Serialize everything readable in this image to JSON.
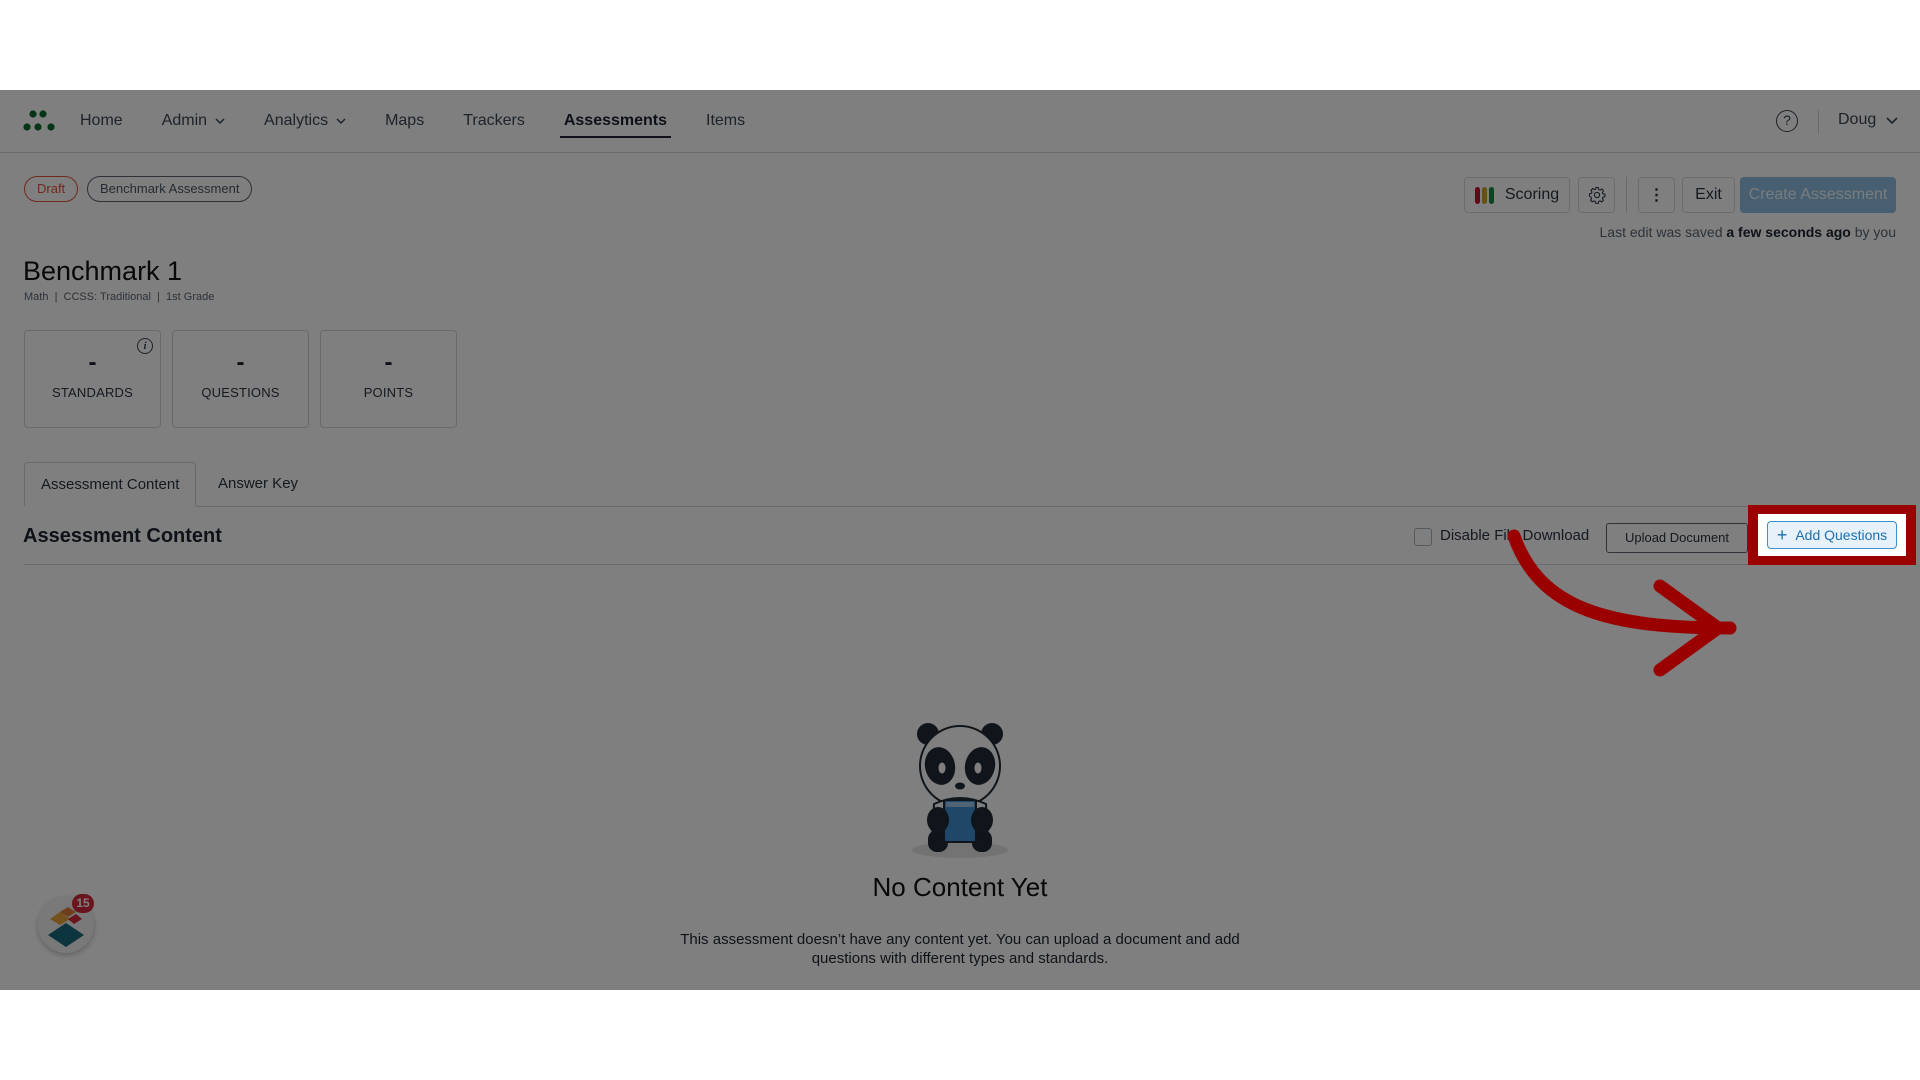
{
  "nav": {
    "items": [
      {
        "label": "Home",
        "has_dropdown": false,
        "active": false
      },
      {
        "label": "Admin",
        "has_dropdown": true,
        "active": false
      },
      {
        "label": "Analytics",
        "has_dropdown": true,
        "active": false
      },
      {
        "label": "Maps",
        "has_dropdown": false,
        "active": false
      },
      {
        "label": "Trackers",
        "has_dropdown": false,
        "active": false
      },
      {
        "label": "Assessments",
        "has_dropdown": false,
        "active": true
      },
      {
        "label": "Items",
        "has_dropdown": false,
        "active": false
      }
    ],
    "help_icon": "?",
    "user_name": "Doug"
  },
  "badges": {
    "status": "Draft",
    "type": "Benchmark Assessment"
  },
  "toolbar": {
    "scoring_label": "Scoring",
    "scoring_colors": [
      "#c8102e",
      "#c9a227",
      "#1f8a3c"
    ],
    "kebab_icon": "⋮",
    "exit_label": "Exit",
    "create_label": "Create Assessment",
    "saved_prefix": "Last edit was saved ",
    "saved_time": "a few seconds ago",
    "saved_suffix": " by you"
  },
  "assessment": {
    "title": "Benchmark 1",
    "meta": "Math  |  CCSS: Traditional  |  1st Grade"
  },
  "stats": [
    {
      "value": "-",
      "label": "STANDARDS",
      "info_icon": "i"
    },
    {
      "value": "-",
      "label": "QUESTIONS"
    },
    {
      "value": "-",
      "label": "POINTS"
    }
  ],
  "tabs": [
    {
      "label": "Assessment Content",
      "active": true
    },
    {
      "label": "Answer Key",
      "active": false
    }
  ],
  "content": {
    "section_title": "Assessment Content",
    "disable_download_label": "Disable File Download",
    "upload_label": "Upload Document",
    "add_questions_label": "Add Questions",
    "add_icon": "+"
  },
  "empty_state": {
    "title": "No Content Yet",
    "description": "This assessment doesn’t have any content yet. You can upload a document and add questions with different types and standards."
  },
  "widget": {
    "notification_count": "15"
  },
  "annotation": {
    "highlight_color": "#9b0000",
    "target": "Add Questions"
  }
}
